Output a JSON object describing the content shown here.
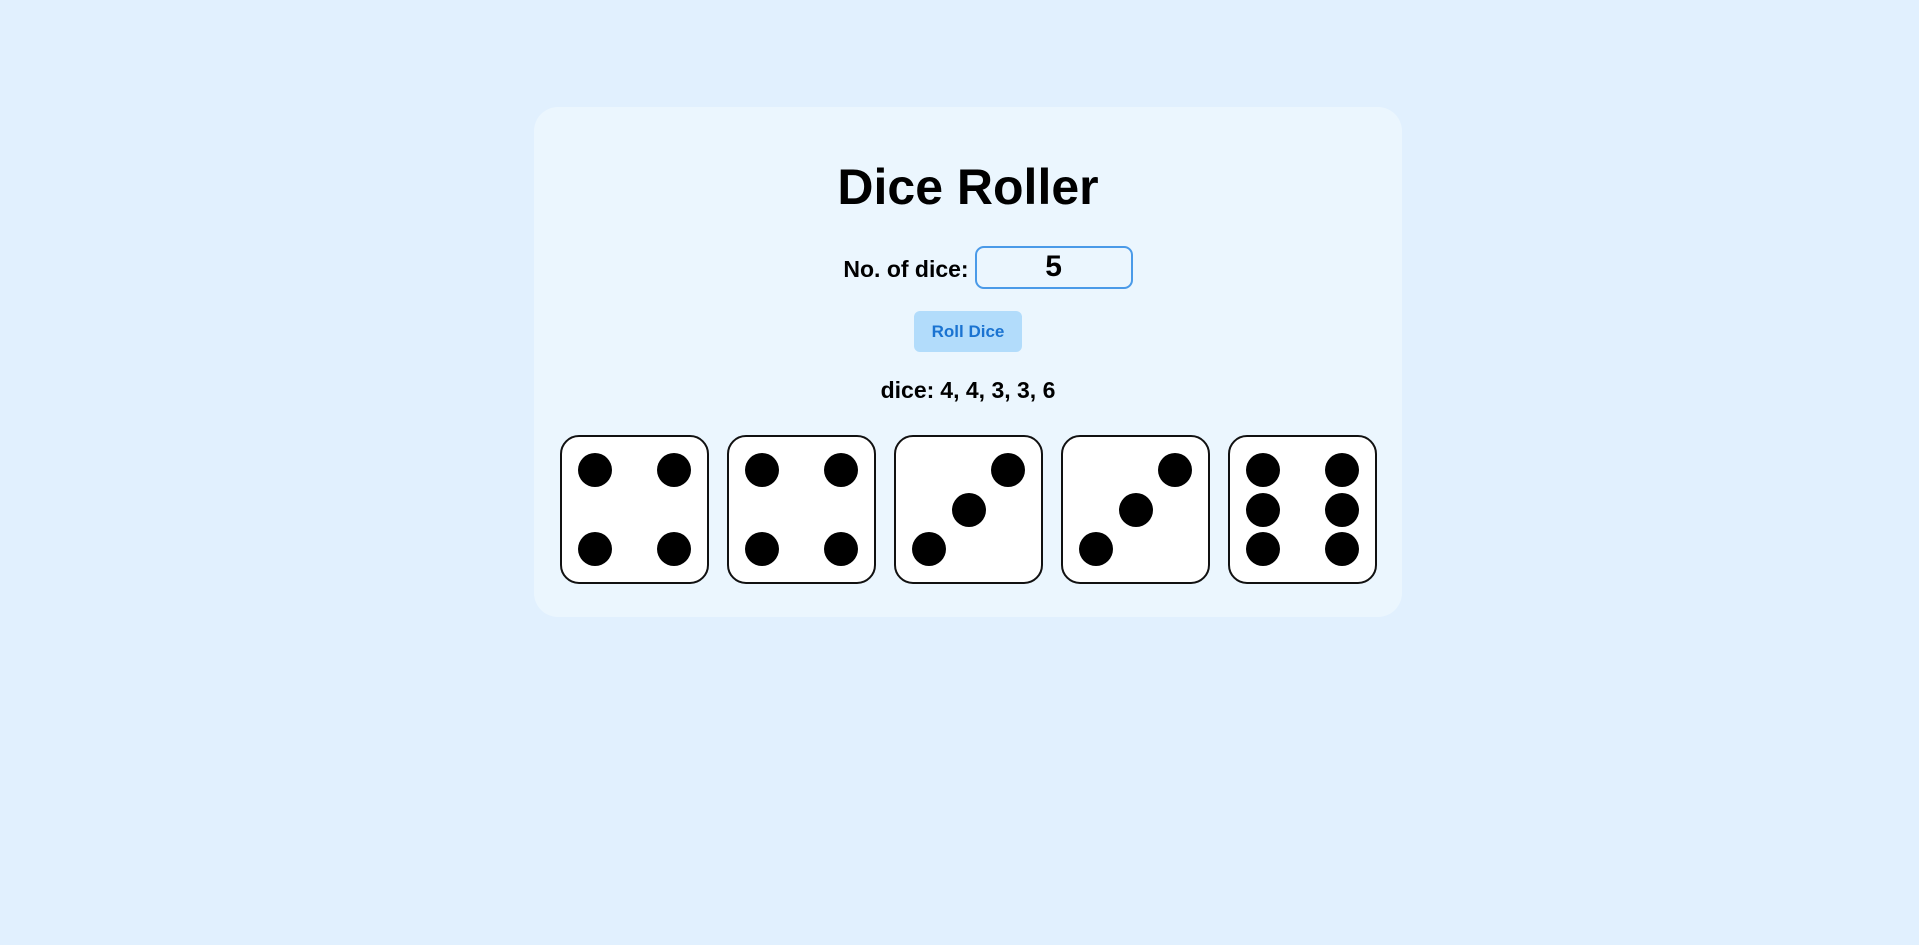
{
  "app": {
    "title": "Dice Roller"
  },
  "controls": {
    "count_label": "No. of dice:",
    "count_value": "5",
    "roll_label": "Roll Dice"
  },
  "result": {
    "prefix": "dice:",
    "values_text": "4, 4, 3, 3, 6"
  },
  "dice": [
    4,
    4,
    3,
    3,
    6
  ],
  "colors": {
    "background": "#e1f0fe",
    "card": "#ebf6fe",
    "accent": "#4a9ae8",
    "button_bg": "#b2dcfb",
    "button_text": "#1a73d1",
    "pip": "#000000"
  }
}
